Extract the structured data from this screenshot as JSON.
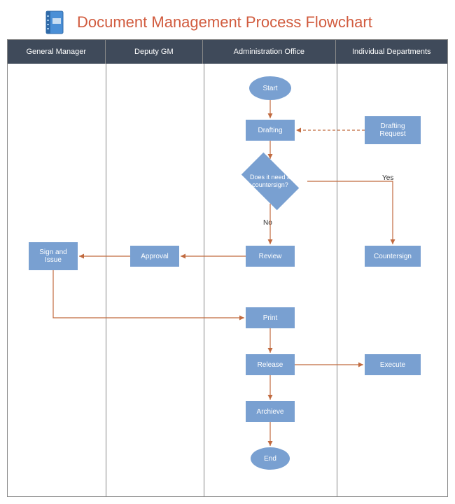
{
  "title": "Document Management Process Flowchart",
  "lanes": {
    "gm": "General Manager",
    "dgm": "Deputy GM",
    "admin": "Administration Office",
    "dept": "Individual Departments"
  },
  "nodes": {
    "start": "Start",
    "drafting": "Drafting",
    "drafting_request": "Drafting\nRequest",
    "decision": "Does it need a\ncountersign?",
    "review": "Review",
    "countersign": "Countersign",
    "approval": "Approval",
    "sign_issue": "Sign and\nIssue",
    "print": "Print",
    "release": "Release",
    "execute": "Execute",
    "archive": "Archieve",
    "end": "End"
  },
  "edge_labels": {
    "yes": "Yes",
    "no": "No"
  },
  "colors": {
    "shape": "#79a0d1",
    "header": "#3f4a5a",
    "titleColor": "#d15b3e",
    "arrow": "#c16a3f"
  }
}
